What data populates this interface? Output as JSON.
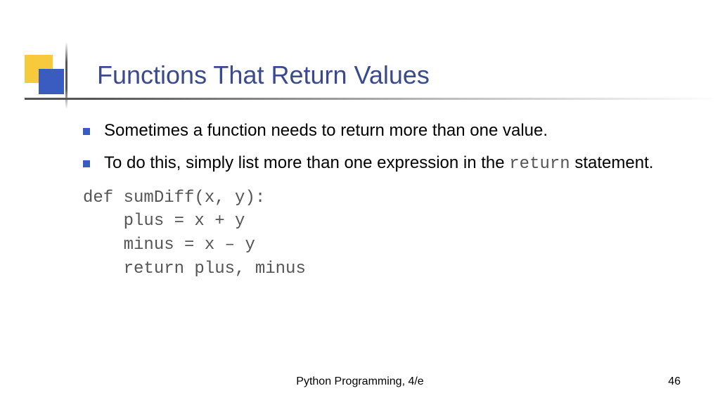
{
  "title": "Functions That Return Values",
  "bullets": [
    {
      "pre": "Sometimes a function needs to return more than one value.",
      "mono": "",
      "post": ""
    },
    {
      "pre": "To do this, simply list more than one expression in the ",
      "mono": "return",
      "post": " statement."
    }
  ],
  "code": "def sumDiff(x, y):\n    plus = x + y\n    minus = x – y\n    return plus, minus",
  "footer": {
    "center": "Python Programming, 4/e",
    "page": "46"
  }
}
